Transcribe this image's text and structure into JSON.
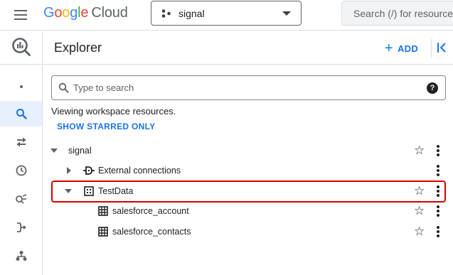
{
  "topbar": {
    "logo": {
      "g1": "G",
      "o1": "o",
      "o2": "o",
      "g2": "g",
      "l": "l",
      "e": "e",
      "cloud": "Cloud"
    },
    "project_name": "signal",
    "search_placeholder": "Search (/) for resources"
  },
  "rail": {
    "items": [
      "bigquery-logo-icon",
      "dot-icon",
      "search-icon",
      "transfer-icon",
      "history-icon",
      "analytics-icon",
      "pipeline-icon",
      "dataform-icon"
    ],
    "active_item": "search-icon"
  },
  "explorer": {
    "title": "Explorer",
    "add_label": "ADD",
    "search_placeholder": "Type to search",
    "help_symbol": "?",
    "viewing_text": "Viewing workspace resources.",
    "starred_link": "SHOW STARRED ONLY"
  },
  "tree": {
    "root": {
      "label": "signal",
      "expanded": true
    },
    "external": {
      "label": "External connections",
      "expanded": false
    },
    "dataset": {
      "label": "TestData",
      "expanded": true,
      "highlighted": true
    },
    "tables": [
      {
        "label": "salesforce_account"
      },
      {
        "label": "salesforce_contacts"
      }
    ]
  },
  "colors": {
    "accent": "#1a73e8",
    "highlight_border": "#d50000",
    "active_rail_bg": "#e8f0fe"
  }
}
